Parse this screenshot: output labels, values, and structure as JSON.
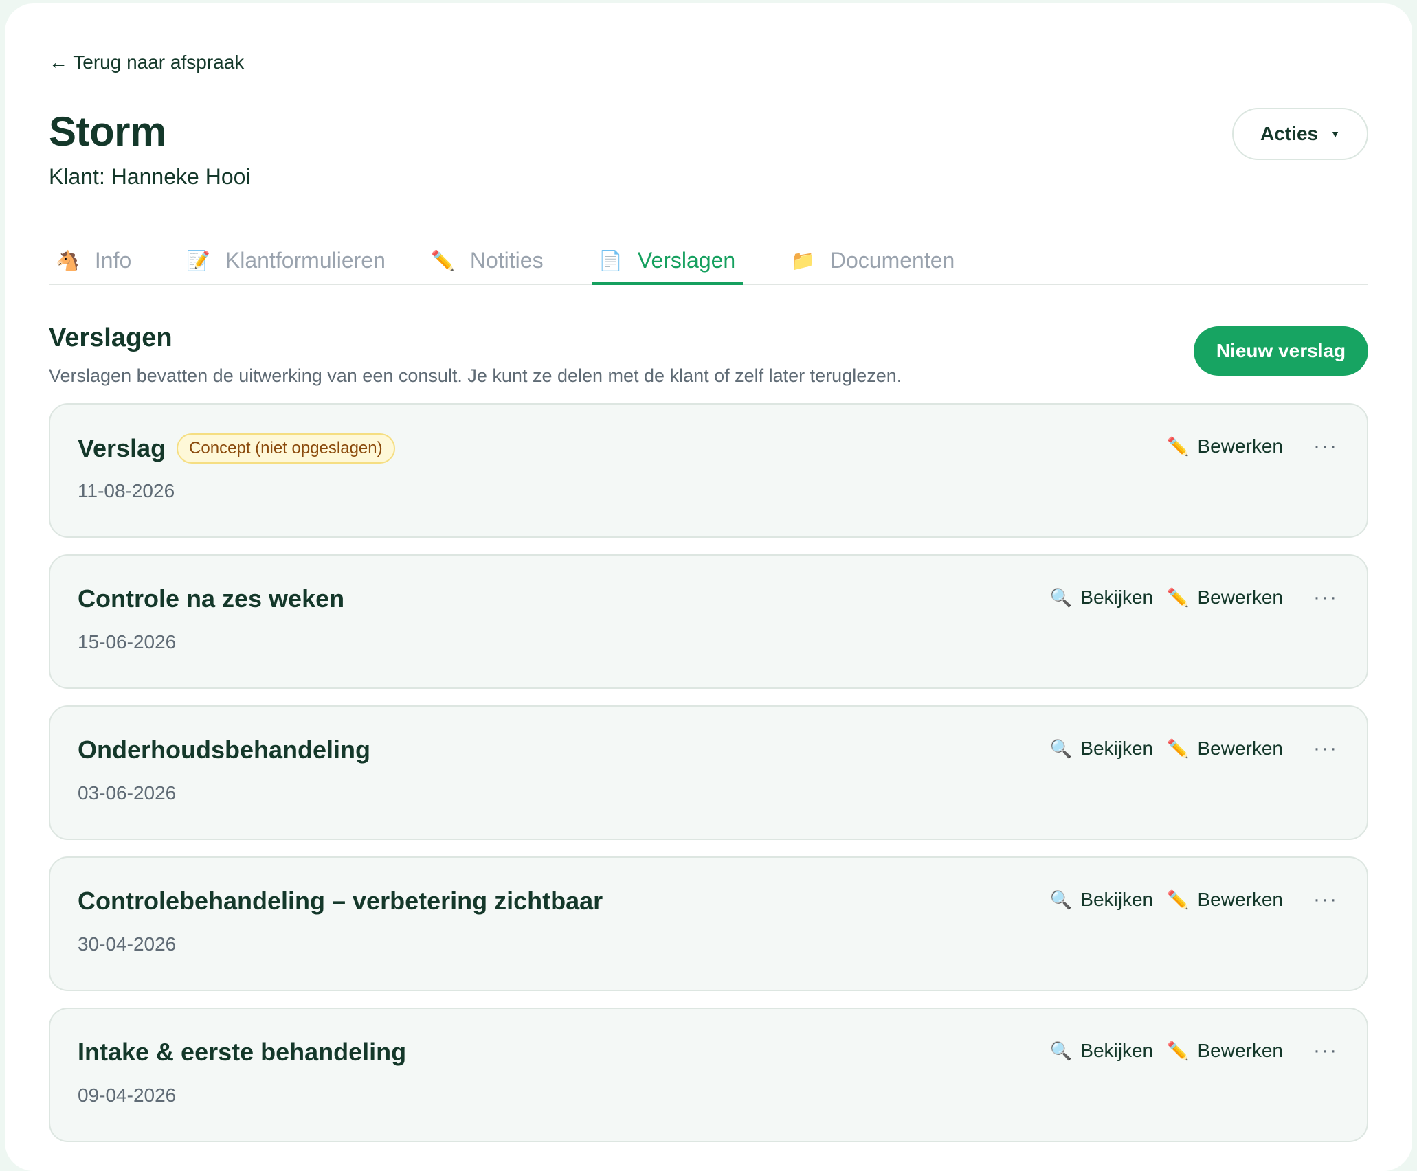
{
  "nav": {
    "back_label": "← Terug naar afspraak"
  },
  "header": {
    "title": "Storm",
    "subtitle": "Klant: Hanneke Hooi",
    "actions_label": "Acties",
    "actions_caret": "▼"
  },
  "tabs": [
    {
      "icon": "horse-icon",
      "glyph": "🐴",
      "label": "Info",
      "active": false
    },
    {
      "icon": "memo-icon",
      "glyph": "📝",
      "label": "Klantformulieren",
      "active": false
    },
    {
      "icon": "pencil-icon",
      "glyph": "✏️",
      "label": "Notities",
      "active": false
    },
    {
      "icon": "page-icon",
      "glyph": "📄",
      "label": "Verslagen",
      "active": true
    },
    {
      "icon": "folder-icon",
      "glyph": "📁",
      "label": "Documenten",
      "active": false
    }
  ],
  "section": {
    "title": "Verslagen",
    "description": "Verslagen bevatten de uitwerking van een consult. Je kunt ze delen met de klant of zelf later teruglezen.",
    "new_button": "Nieuw verslag"
  },
  "actions": {
    "view_label": "Bekijken",
    "view_glyph": "🔍",
    "edit_label": "Bewerken",
    "edit_glyph": "✏️",
    "more_glyph": "···"
  },
  "reports": [
    {
      "title": "Verslag",
      "badge": "Concept (niet opgeslagen)",
      "date": "11-08-2026",
      "can_view": false
    },
    {
      "title": "Controle na zes weken",
      "date": "15-06-2026",
      "can_view": true
    },
    {
      "title": "Onderhoudsbehandeling",
      "date": "03-06-2026",
      "can_view": true
    },
    {
      "title": "Controlebehandeling – verbetering zichtbaar",
      "date": "30-04-2026",
      "can_view": true
    },
    {
      "title": "Intake & eerste behandeling",
      "date": "09-04-2026",
      "can_view": true
    }
  ],
  "colors": {
    "accent": "#16a05f",
    "text": "#14382a",
    "muted": "#5f6b75",
    "card_bg": "#f4f8f6",
    "badge_bg": "#fef8d8"
  }
}
